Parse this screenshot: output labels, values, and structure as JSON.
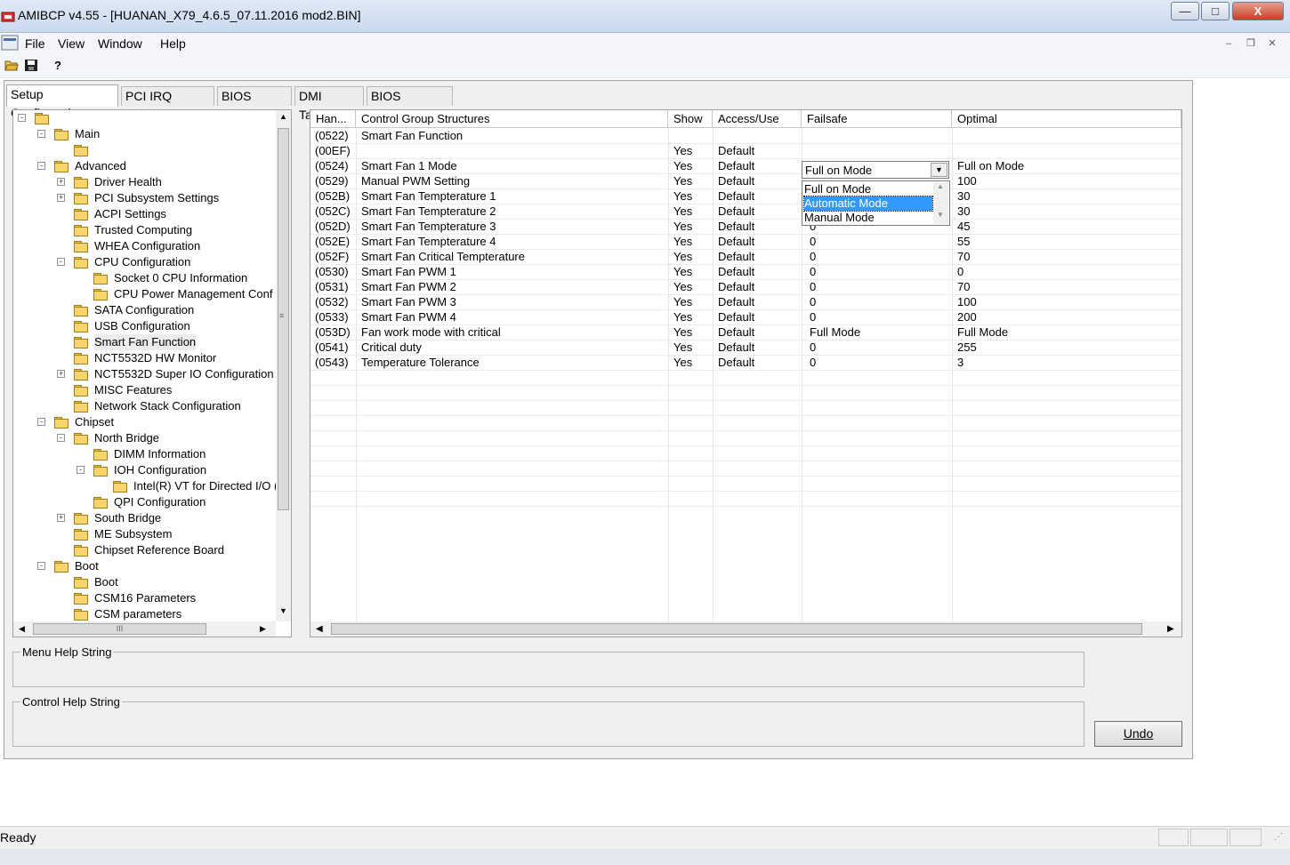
{
  "window": {
    "title": "AMIBCP v4.55 - [HUANAN_X79_4.6.5_07.11.2016 mod2.BIN]",
    "minimize": "—",
    "maximize": "□",
    "close": "X"
  },
  "menu": [
    "File",
    "View",
    "Window",
    "Help"
  ],
  "toolbar": {
    "open_icon": "open-folder-icon",
    "save_icon": "save-icon",
    "help_icon": "help-icon",
    "help_glyph": "?"
  },
  "tabs": [
    {
      "label": "Setup Configuration",
      "active": true
    },
    {
      "label": "PCI IRQ Routing",
      "active": false
    },
    {
      "label": "BIOS Strings",
      "active": false
    },
    {
      "label": "DMI Tables",
      "active": false
    },
    {
      "label": "BIOS Features",
      "active": false
    }
  ],
  "tree": [
    {
      "label": "",
      "level": 0,
      "expander": "-"
    },
    {
      "label": "Main",
      "level": 1,
      "expander": "-"
    },
    {
      "label": "",
      "level": 2,
      "expander": ""
    },
    {
      "label": "Advanced",
      "level": 1,
      "expander": "-"
    },
    {
      "label": "Driver Health",
      "level": 2,
      "expander": "+"
    },
    {
      "label": "PCI Subsystem Settings",
      "level": 2,
      "expander": "+"
    },
    {
      "label": "ACPI Settings",
      "level": 2,
      "expander": ""
    },
    {
      "label": "Trusted Computing",
      "level": 2,
      "expander": ""
    },
    {
      "label": "WHEA Configuration",
      "level": 2,
      "expander": ""
    },
    {
      "label": "CPU Configuration",
      "level": 2,
      "expander": "-"
    },
    {
      "label": "Socket 0 CPU Information",
      "level": 3,
      "expander": ""
    },
    {
      "label": "CPU Power Management Conf",
      "level": 3,
      "expander": ""
    },
    {
      "label": "SATA Configuration",
      "level": 2,
      "expander": ""
    },
    {
      "label": "USB Configuration",
      "level": 2,
      "expander": ""
    },
    {
      "label": "Smart Fan Function",
      "level": 2,
      "expander": "",
      "selected": true
    },
    {
      "label": "NCT5532D HW Monitor",
      "level": 2,
      "expander": ""
    },
    {
      "label": "NCT5532D Super IO Configuration",
      "level": 2,
      "expander": "+"
    },
    {
      "label": "MISC Features",
      "level": 2,
      "expander": ""
    },
    {
      "label": "Network Stack Configuration",
      "level": 2,
      "expander": ""
    },
    {
      "label": "Chipset",
      "level": 1,
      "expander": "-"
    },
    {
      "label": "North Bridge",
      "level": 2,
      "expander": "-"
    },
    {
      "label": "DIMM Information",
      "level": 3,
      "expander": ""
    },
    {
      "label": "IOH Configuration",
      "level": 3,
      "expander": "-"
    },
    {
      "label": "Intel(R) VT for Directed I/O (",
      "level": 4,
      "expander": ""
    },
    {
      "label": "QPI Configuration",
      "level": 3,
      "expander": ""
    },
    {
      "label": "South Bridge",
      "level": 2,
      "expander": "+"
    },
    {
      "label": "ME Subsystem",
      "level": 2,
      "expander": ""
    },
    {
      "label": "Chipset Reference Board",
      "level": 2,
      "expander": ""
    },
    {
      "label": "Boot",
      "level": 1,
      "expander": "-"
    },
    {
      "label": "Boot",
      "level": 2,
      "expander": ""
    },
    {
      "label": "CSM16 Parameters",
      "level": 2,
      "expander": ""
    },
    {
      "label": "CSM parameters",
      "level": 2,
      "expander": ""
    }
  ],
  "tree_hscroll_glyph": "III",
  "grid": {
    "headers": [
      "Han...",
      "Control Group Structures",
      "Show",
      "Access/Use",
      "Failsafe",
      "Optimal"
    ],
    "rows": [
      [
        "(0522)",
        "Smart Fan Function",
        "",
        "",
        "",
        ""
      ],
      [
        "(00EF)",
        "",
        "Yes",
        "Default",
        "",
        ""
      ],
      [
        "(0524)",
        "Smart Fan 1 Mode",
        "Yes",
        "Default",
        "",
        "Full on Mode"
      ],
      [
        "(0529)",
        "Manual PWM Setting",
        "Yes",
        "Default",
        "",
        "100"
      ],
      [
        "(052B)",
        "Smart Fan Tempterature 1",
        "Yes",
        "Default",
        "",
        "30"
      ],
      [
        "(052C)",
        "Smart Fan Tempterature 2",
        "Yes",
        "Default",
        "",
        "30"
      ],
      [
        "(052D)",
        "Smart Fan Tempterature 3",
        "Yes",
        "Default",
        "0",
        "45"
      ],
      [
        "(052E)",
        "Smart Fan Tempterature 4",
        "Yes",
        "Default",
        "0",
        "55"
      ],
      [
        "(052F)",
        "Smart Fan Critical Tempterature",
        "Yes",
        "Default",
        "0",
        "70"
      ],
      [
        "(0530)",
        "Smart Fan PWM 1",
        "Yes",
        "Default",
        "0",
        "0"
      ],
      [
        "(0531)",
        "Smart Fan PWM 2",
        "Yes",
        "Default",
        "0",
        "70"
      ],
      [
        "(0532)",
        "Smart Fan PWM 3",
        "Yes",
        "Default",
        "0",
        "100"
      ],
      [
        "(0533)",
        "Smart Fan PWM 4",
        "Yes",
        "Default",
        "0",
        "200"
      ],
      [
        "(053D)",
        "Fan work mode with critical",
        "Yes",
        "Default",
        "Full Mode",
        "Full Mode"
      ],
      [
        "(0541)",
        "Critical duty",
        "Yes",
        "Default",
        "0",
        "255"
      ],
      [
        "(0543)",
        "Temperature Tolerance",
        "Yes",
        "Default",
        "0",
        "3"
      ]
    ]
  },
  "dropdown": {
    "value": "Full on Mode",
    "options": [
      "Full on Mode",
      "Automatic Mode",
      "Manual Mode"
    ],
    "highlighted": "Automatic Mode"
  },
  "menu_help_label": "Menu Help String",
  "control_help_label": "Control Help String",
  "undo_label": "Undo",
  "status": "Ready"
}
